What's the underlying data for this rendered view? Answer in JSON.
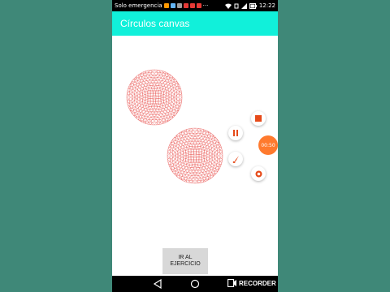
{
  "status_bar": {
    "carrier": "Solo emergencia",
    "time": "12:22"
  },
  "app_bar": {
    "title": "Círculos canvas"
  },
  "recorder": {
    "timer": "00:50",
    "buttons": [
      "stop-icon",
      "pause-icon",
      "brush-icon",
      "camera-icon"
    ]
  },
  "main": {
    "go_button_line1": "IR AL",
    "go_button_line2": "EJERCICIO"
  },
  "nav_bar": {
    "recorder_label": "RECORDER"
  },
  "colors": {
    "accent": "#11f0da",
    "circle_stroke": "#e53935",
    "timer_orange": "#ff7a2e"
  }
}
